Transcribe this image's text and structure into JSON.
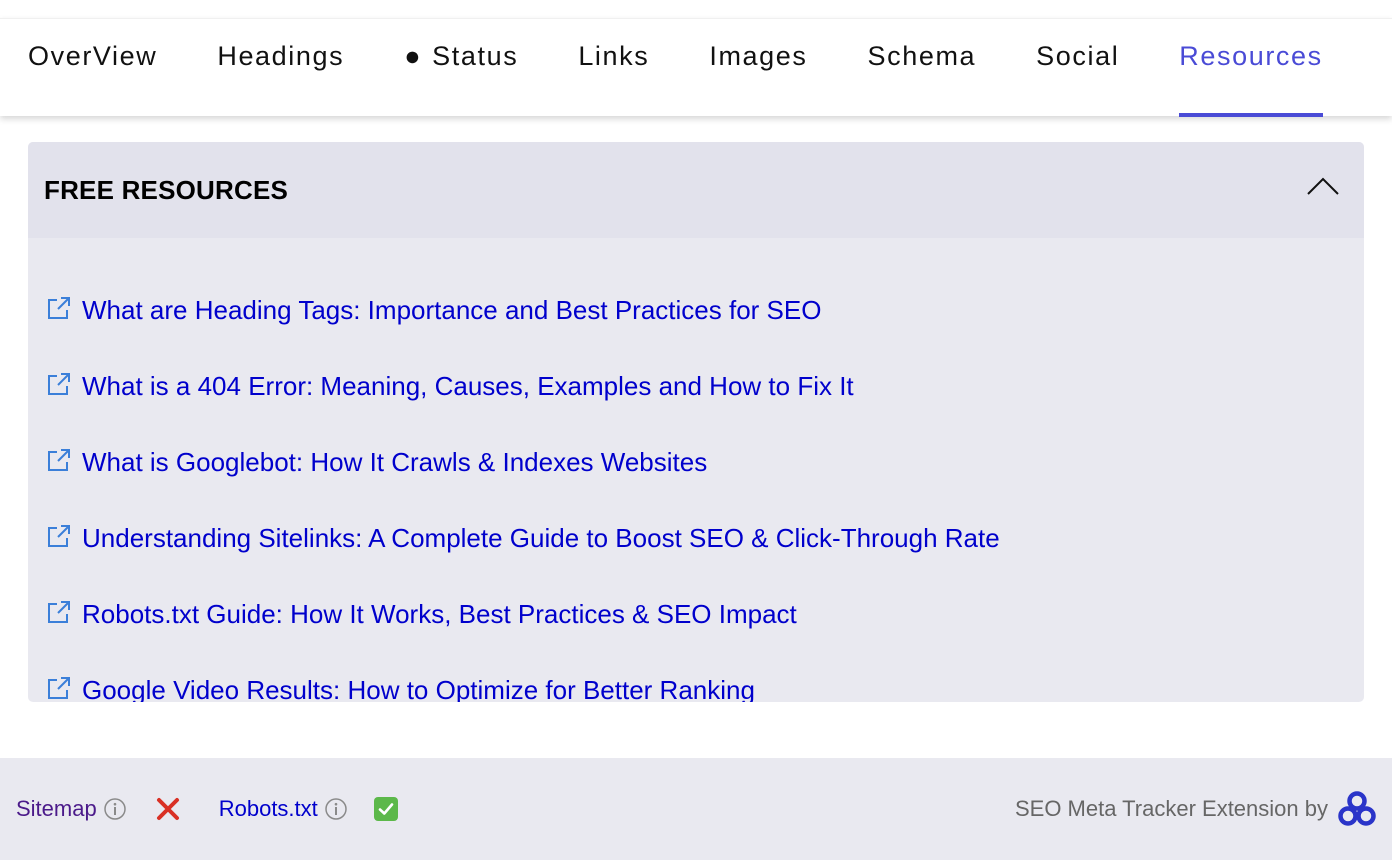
{
  "tabs": [
    {
      "label": "OverView",
      "dot": ""
    },
    {
      "label": "Headings",
      "dot": ""
    },
    {
      "label": "Status",
      "dot": "●"
    },
    {
      "label": "Links",
      "dot": ""
    },
    {
      "label": "Images",
      "dot": ""
    },
    {
      "label": "Schema",
      "dot": ""
    },
    {
      "label": "Social",
      "dot": ""
    },
    {
      "label": "Resources",
      "dot": "",
      "active": true
    }
  ],
  "panel": {
    "title": "FREE RESOURCES",
    "toggle_icon": "chevron-up-icon",
    "items": [
      {
        "label": "What are Heading Tags: Importance and Best Practices for SEO",
        "icon": "external-link-icon"
      },
      {
        "label": "What is a 404 Error: Meaning, Causes, Examples and How to Fix It",
        "icon": "external-link-icon"
      },
      {
        "label": "What is Googlebot: How It Crawls & Indexes Websites",
        "icon": "external-link-icon"
      },
      {
        "label": "Understanding Sitelinks: A Complete Guide to Boost SEO & Click-Through Rate",
        "icon": "external-link-icon"
      },
      {
        "label": "Robots.txt Guide: How It Works, Best Practices & SEO Impact",
        "icon": "external-link-icon"
      },
      {
        "label": "Google Video Results: How to Optimize for Better Ranking",
        "icon": "external-link-icon"
      }
    ]
  },
  "footer": {
    "sitemap_label": "Sitemap",
    "sitemap_status": "missing",
    "robots_label": "Robots.txt",
    "robots_status": "present",
    "credit": "SEO Meta Tracker Extension by"
  },
  "colors": {
    "accent": "#4a4bd6",
    "link": "#0000cc",
    "visited_link": "#4b1a8a",
    "panel_bg": "#e9e9f0",
    "panel_header_bg": "#e2e2ec",
    "error": "#d93025",
    "success": "#5cb84a",
    "icon_blue": "#3b7fd9"
  }
}
